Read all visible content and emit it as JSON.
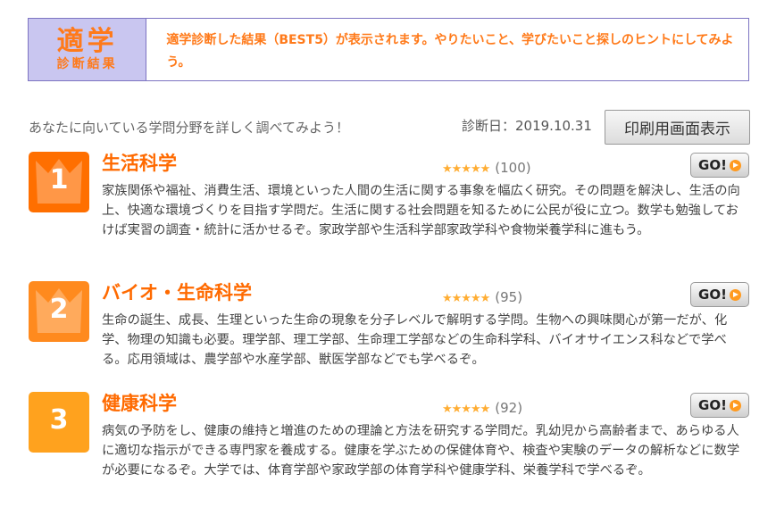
{
  "banner": {
    "badge_main": "適学",
    "badge_sub": "診断結果",
    "message": "適学診断した結果（BEST5）が表示されます。やりたいこと、学びたいこと探しのヒントにしてみよう。"
  },
  "intro_text": "あなたに向いている学問分野を詳しく調べてみよう！",
  "diagnosis_date": "診断日：2019.10.31",
  "print_label": "印刷用画面表示",
  "results": [
    {
      "rank": "1",
      "color": "#ff6f00",
      "title": "生活科学",
      "stars": "★★★★★",
      "count": "(100)",
      "go_label": "GO!",
      "description": "家族関係や福祉、消費生活、環境といった人間の生活に関する事象を幅広く研究。その問題を解決し、生活の向上、快適な環境づくりを目指す学問だ。生活に関する社会問題を知るために公民が役に立つ。数学も勉強しておけば実習の調査・統計に活かせるぞ。家政学部や生活科学部家政学科や食物栄養学科に進もう。"
    },
    {
      "rank": "2",
      "color": "#ff8a1e",
      "title": "バイオ・生命科学",
      "stars": "★★★★★",
      "count": "(95)",
      "go_label": "GO!",
      "description": "生命の誕生、成長、生理といった生命の現象を分子レベルで解明する学問。生物への興味関心が第一だが、化学、物理の知識も必要。理学部、理工学部、生命理工学部などの生命科学科、バイオサイエンス科などで学べる。応用領域は、農学部や水産学部、獣医学部などでも学べるぞ。"
    },
    {
      "rank": "3",
      "color": "#ffa21e",
      "title": "健康科学",
      "stars": "★★★★★",
      "count": "(92)",
      "go_label": "GO!",
      "description": "病気の予防をし、健康の維持と増進のための理論と方法を研究する学問だ。乳幼児から高齢者まで、あらゆる人に適切な指示ができる専門家を養成する。健康を学ぶための保健体育や、検査や実験のデータの解析などに数学が必要になるぞ。大学では、体育学部や家政学部の体育学科や健康学科、栄養学科で学べるぞ。"
    }
  ]
}
